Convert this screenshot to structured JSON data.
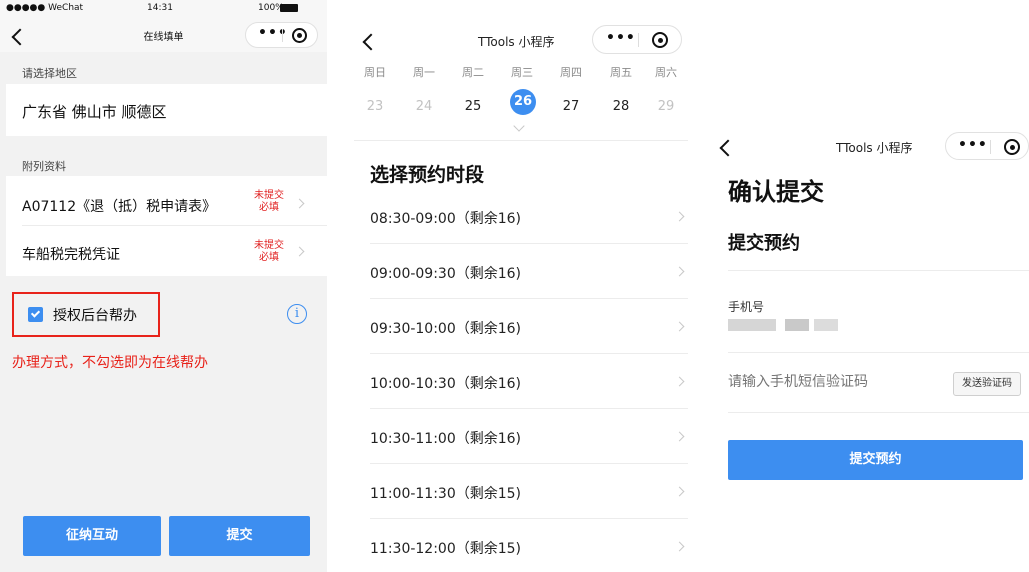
{
  "screen1": {
    "status_bar": {
      "carrier": "●●●●● WeChat",
      "time": "14:31",
      "battery": "100%"
    },
    "nav_title": "在线填单",
    "region_label": "请选择地区",
    "region_value": "广东省 佛山市 顺德区",
    "attachments_label": "附列资料",
    "attachments": [
      {
        "name": "A07112《退（抵）税申请表》",
        "status_line1": "未提交",
        "status_line2": "必填"
      },
      {
        "name": "车船税完税凭证",
        "status_line1": "未提交",
        "status_line2": "必填"
      }
    ],
    "authorize_label": "授权后台帮办",
    "authorize_checked": true,
    "note": "办理方式，不勾选即为在线帮办",
    "buttons": {
      "interact": "征纳互动",
      "submit": "提交"
    },
    "colors": {
      "accent": "#3d8ef0",
      "warning": "#e8231b"
    }
  },
  "screen2": {
    "title": "TTools 小程序",
    "weekdays": [
      "周日",
      "周一",
      "周二",
      "周三",
      "周四",
      "周五",
      "周六"
    ],
    "days": [
      {
        "label": "23",
        "state": "inactive"
      },
      {
        "label": "24",
        "state": "inactive"
      },
      {
        "label": "25",
        "state": "active"
      },
      {
        "label": "26",
        "state": "selected"
      },
      {
        "label": "27",
        "state": "active"
      },
      {
        "label": "28",
        "state": "active"
      },
      {
        "label": "29",
        "state": "inactive"
      }
    ],
    "section_title": "选择预约时段",
    "slots": [
      "08:30-09:00（剩余16)",
      "09:00-09:30（剩余16)",
      "09:30-10:00（剩余16)",
      "10:00-10:30（剩余16)",
      "10:30-11:00（剩余16)",
      "11:00-11:30（剩余15)",
      "11:30-12:00（剩余15)"
    ]
  },
  "screen3": {
    "title": "TTools 小程序",
    "heading": "确认提交",
    "subheading": "提交预约",
    "phone_label": "手机号",
    "code_placeholder": "请输入手机短信验证码",
    "send_code": "发送验证码",
    "submit": "提交预约"
  }
}
